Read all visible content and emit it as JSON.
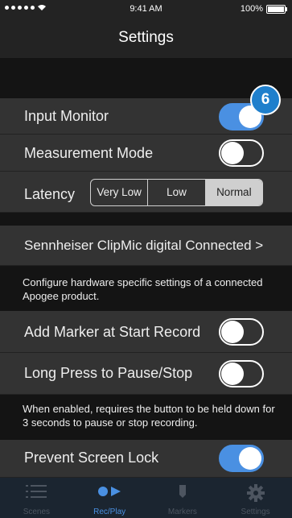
{
  "status_bar": {
    "time": "9:41 AM",
    "battery": "100%",
    "signal_icon": "signal-dots-icon",
    "wifi_icon": "wifi-icon",
    "battery_icon": "battery-icon"
  },
  "nav": {
    "title": "Settings"
  },
  "settings": {
    "input_monitor": {
      "label": "Input Monitor",
      "on": true
    },
    "measurement_mode": {
      "label": "Measurement Mode",
      "on": false
    },
    "latency": {
      "label": "Latency",
      "options": [
        "Very Low",
        "Low",
        "Normal"
      ],
      "selected": "Normal"
    },
    "device": {
      "label": "Sennheiser ClipMic digital Connected >"
    },
    "device_note": "Configure hardware specific settings of a connected Apogee product.",
    "add_marker": {
      "label": "Add Marker at Start Record",
      "on": false
    },
    "long_press": {
      "label": "Long Press to Pause/Stop",
      "on": false
    },
    "long_press_note": "When enabled, requires the button to be held down for 3 seconds to pause or stop recording.",
    "prevent_lock": {
      "label": "Prevent Screen Lock",
      "on": true
    }
  },
  "badge": {
    "value": "6"
  },
  "colors": {
    "accent": "#4a90e2",
    "row_bg": "#333333",
    "section_bg": "#141414",
    "tabbar_bg": "#1b2530"
  },
  "tabs": [
    {
      "label": "Scenes",
      "icon": "list-icon",
      "active": false
    },
    {
      "label": "Rec/Play",
      "icon": "record-play-icon",
      "active": true
    },
    {
      "label": "Markers",
      "icon": "marker-icon",
      "active": false
    },
    {
      "label": "Settings",
      "icon": "gear-icon",
      "active": false
    }
  ]
}
